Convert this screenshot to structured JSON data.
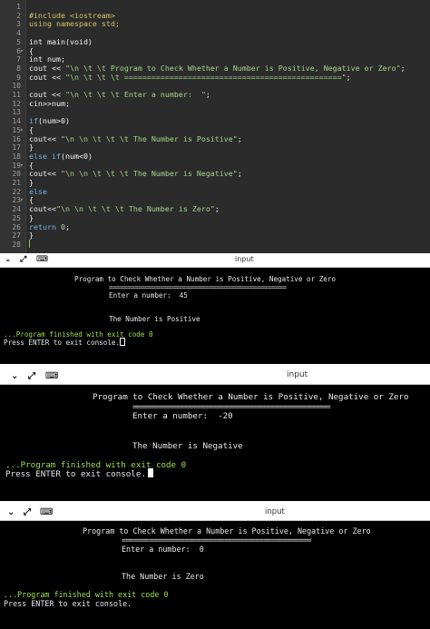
{
  "editor": {
    "lines": [
      {
        "n": "1",
        "parts": []
      },
      {
        "n": "2",
        "parts": [
          {
            "t": "#include <iostream>",
            "c": "pp"
          }
        ]
      },
      {
        "n": "3",
        "parts": [
          {
            "t": "using namespace std;",
            "c": "pp"
          }
        ]
      },
      {
        "n": "4",
        "parts": []
      },
      {
        "n": "5",
        "parts": [
          {
            "t": "int main(void)",
            "c": ""
          }
        ]
      },
      {
        "n": "6",
        "fold": true,
        "parts": [
          {
            "t": "{",
            "c": ""
          }
        ]
      },
      {
        "n": "7",
        "parts": [
          {
            "t": "int num;",
            "c": ""
          }
        ]
      },
      {
        "n": "8",
        "parts": [
          {
            "t": "cout << ",
            "c": ""
          },
          {
            "t": "\"\\n \\t \\t Program to Check Whether a Number is Positive, Negative or Zero\"",
            "c": "str"
          },
          {
            "t": ";",
            "c": ""
          }
        ]
      },
      {
        "n": "9",
        "parts": [
          {
            "t": "cout << ",
            "c": ""
          },
          {
            "t": "\"\\n \\t \\t \\t ================================================\"",
            "c": "str"
          },
          {
            "t": ";",
            "c": ""
          }
        ]
      },
      {
        "n": "10",
        "parts": []
      },
      {
        "n": "11",
        "parts": [
          {
            "t": "cout << ",
            "c": ""
          },
          {
            "t": "\"\\n \\t \\t \\t Enter a number:  \"",
            "c": "str"
          },
          {
            "t": ";",
            "c": ""
          }
        ]
      },
      {
        "n": "12",
        "parts": [
          {
            "t": "cin>>num;",
            "c": ""
          }
        ]
      },
      {
        "n": "13",
        "parts": []
      },
      {
        "n": "14",
        "parts": [
          {
            "t": "if",
            "c": "kw"
          },
          {
            "t": "(num>0)",
            "c": ""
          }
        ]
      },
      {
        "n": "15",
        "fold": true,
        "parts": [
          {
            "t": "{",
            "c": ""
          }
        ]
      },
      {
        "n": "16",
        "parts": [
          {
            "t": "cout<< ",
            "c": ""
          },
          {
            "t": "\"\\n \\n \\t \\t \\t The Number is Positive\"",
            "c": "str"
          },
          {
            "t": ";",
            "c": ""
          }
        ]
      },
      {
        "n": "17",
        "parts": [
          {
            "t": "}",
            "c": ""
          }
        ]
      },
      {
        "n": "18",
        "parts": [
          {
            "t": "else if",
            "c": "kw"
          },
          {
            "t": "(num<0)",
            "c": ""
          }
        ]
      },
      {
        "n": "19",
        "fold": true,
        "parts": [
          {
            "t": "{",
            "c": ""
          }
        ]
      },
      {
        "n": "20",
        "parts": [
          {
            "t": "cout<< ",
            "c": ""
          },
          {
            "t": "\"\\n \\n \\t \\t \\t The Number is Negative\"",
            "c": "str"
          },
          {
            "t": ";",
            "c": ""
          }
        ]
      },
      {
        "n": "21",
        "parts": [
          {
            "t": "}",
            "c": ""
          }
        ]
      },
      {
        "n": "22",
        "parts": [
          {
            "t": "else",
            "c": "kw"
          }
        ]
      },
      {
        "n": "23",
        "fold": true,
        "parts": [
          {
            "t": "{",
            "c": ""
          }
        ]
      },
      {
        "n": "24",
        "parts": [
          {
            "t": "cout<<",
            "c": ""
          },
          {
            "t": "\"\\n \\n \\t \\t \\t The Number is Zero\"",
            "c": "str"
          },
          {
            "t": ";",
            "c": ""
          }
        ]
      },
      {
        "n": "25",
        "parts": [
          {
            "t": "}",
            "c": ""
          }
        ]
      },
      {
        "n": "26",
        "parts": [
          {
            "t": "return ",
            "c": "kw"
          },
          {
            "t": "0",
            "c": "num"
          },
          {
            "t": ";",
            "c": ""
          }
        ]
      },
      {
        "n": "27",
        "parts": [
          {
            "t": "}",
            "c": ""
          }
        ]
      },
      {
        "n": "28",
        "parts": []
      }
    ]
  },
  "panel_title": "input",
  "runs": [
    {
      "heading": "Program to Check Whether a Number is Positive, Negative or Zero",
      "rule": "================================================",
      "prompt": "Enter a number:  45",
      "result": "The Number is Positive",
      "finished": "...Program finished with exit code 0",
      "press": "Press ENTER to exit console."
    },
    {
      "heading": "Program to Check Whether a Number is Positive, Negative or Zero",
      "rule": "================================================",
      "prompt": "Enter a number:  -20",
      "result": "The Number is Negative",
      "finished": "...Program finished with exit code 0",
      "press": "Press ENTER to exit console."
    },
    {
      "heading": "Program to Check Whether a Number is Positive, Negative or Zero",
      "rule": "================================================",
      "prompt": "Enter a number:  0",
      "result": "The Number is Zero",
      "finished": "...Program finished with exit code 0",
      "press": "Press ENTER to exit console."
    }
  ],
  "toolbar": {
    "collapse_icon": "chevron-down-icon",
    "expand_icon": "expand-arrows-icon",
    "keyboard_icon": "keyboard-icon"
  }
}
